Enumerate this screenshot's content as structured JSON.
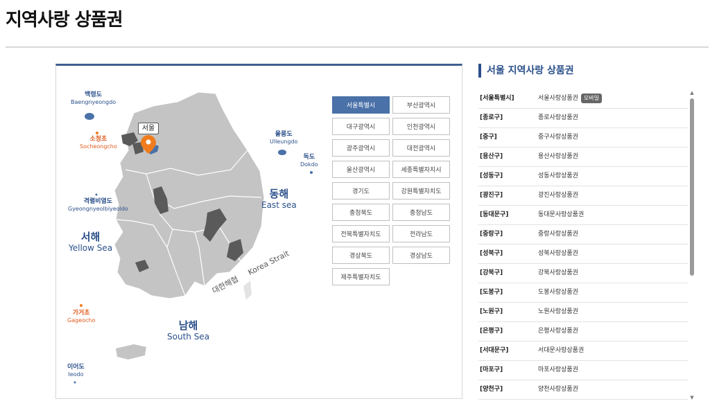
{
  "page": {
    "title": "지역사랑 상품권"
  },
  "map": {
    "pin_label": "서울",
    "islands": [
      {
        "id": "baengnyeongdo",
        "ko": "백령도",
        "en": "Baengnyeongdo",
        "color": "blue"
      },
      {
        "id": "socheongcho",
        "ko": "소청초",
        "en": "Socheongcho",
        "color": "orange"
      },
      {
        "id": "ulleungdo",
        "ko": "울릉도",
        "en": "Ulleungdo",
        "color": "blue"
      },
      {
        "id": "dokdo",
        "ko": "독도",
        "en": "Dokdo",
        "color": "blue"
      },
      {
        "id": "gyeongnyeolbiyeoldo",
        "ko": "격렬비열도",
        "en": "Gyeongnyeolbiyeoldo",
        "color": "blue"
      },
      {
        "id": "gageocho",
        "ko": "가거초",
        "en": "Gageocho",
        "color": "orange"
      },
      {
        "id": "ieodo",
        "ko": "이어도",
        "en": "Ieodo",
        "color": "blue"
      }
    ],
    "seas": [
      {
        "id": "east-sea",
        "ko": "동해",
        "en": "East sea"
      },
      {
        "id": "yellow-sea",
        "ko": "서해",
        "en": "Yellow Sea"
      },
      {
        "id": "south-sea",
        "ko": "남해",
        "en": "South Sea"
      }
    ],
    "strait": {
      "ko": "대한해협",
      "en": "Korea Strait"
    }
  },
  "regions": [
    {
      "label": "서울특별시",
      "active": true
    },
    {
      "label": "부산광역시",
      "active": false
    },
    {
      "label": "대구광역시",
      "active": false
    },
    {
      "label": "인천광역시",
      "active": false
    },
    {
      "label": "광주광역시",
      "active": false
    },
    {
      "label": "대전광역시",
      "active": false
    },
    {
      "label": "울산광역시",
      "active": false
    },
    {
      "label": "세종특별자치시",
      "active": false
    },
    {
      "label": "경기도",
      "active": false
    },
    {
      "label": "강원특별자치도",
      "active": false
    },
    {
      "label": "충청북도",
      "active": false
    },
    {
      "label": "충청남도",
      "active": false
    },
    {
      "label": "전북특별자치도",
      "active": false
    },
    {
      "label": "전라남도",
      "active": false
    },
    {
      "label": "경상북도",
      "active": false
    },
    {
      "label": "경상남도",
      "active": false
    },
    {
      "label": "제주특별자치도",
      "active": false
    }
  ],
  "side": {
    "title": "서울 지역사랑 상품권",
    "vouchers": [
      {
        "district": "[서울특별시]",
        "name": "서울사랑상품권",
        "badge": "모바일"
      },
      {
        "district": "[종로구]",
        "name": "종로사랑상품권"
      },
      {
        "district": "[중구]",
        "name": "중구사랑상품권"
      },
      {
        "district": "[용산구]",
        "name": "용산사랑상품권"
      },
      {
        "district": "[성동구]",
        "name": "성동사랑상품권"
      },
      {
        "district": "[광진구]",
        "name": "광진사랑상품권"
      },
      {
        "district": "[동대문구]",
        "name": "동대문사랑상품권"
      },
      {
        "district": "[중랑구]",
        "name": "중랑사랑상품권"
      },
      {
        "district": "[성북구]",
        "name": "성북사랑상품권"
      },
      {
        "district": "[강북구]",
        "name": "강북사랑상품권"
      },
      {
        "district": "[도봉구]",
        "name": "도봉사랑상품권"
      },
      {
        "district": "[노원구]",
        "name": "노원사랑상품권"
      },
      {
        "district": "[은평구]",
        "name": "은평사랑상품권"
      },
      {
        "district": "[서대문구]",
        "name": "서대문사랑상품권"
      },
      {
        "district": "[마포구]",
        "name": "마포사랑상품권"
      },
      {
        "district": "[양천구]",
        "name": "양천사랑상품권"
      }
    ]
  },
  "colors": {
    "accent": "#2a4f8a",
    "active_region": "#4a71a8",
    "participating": "#5a5a5a",
    "land": "#c4c4c4",
    "pin": "#f07c1e"
  }
}
